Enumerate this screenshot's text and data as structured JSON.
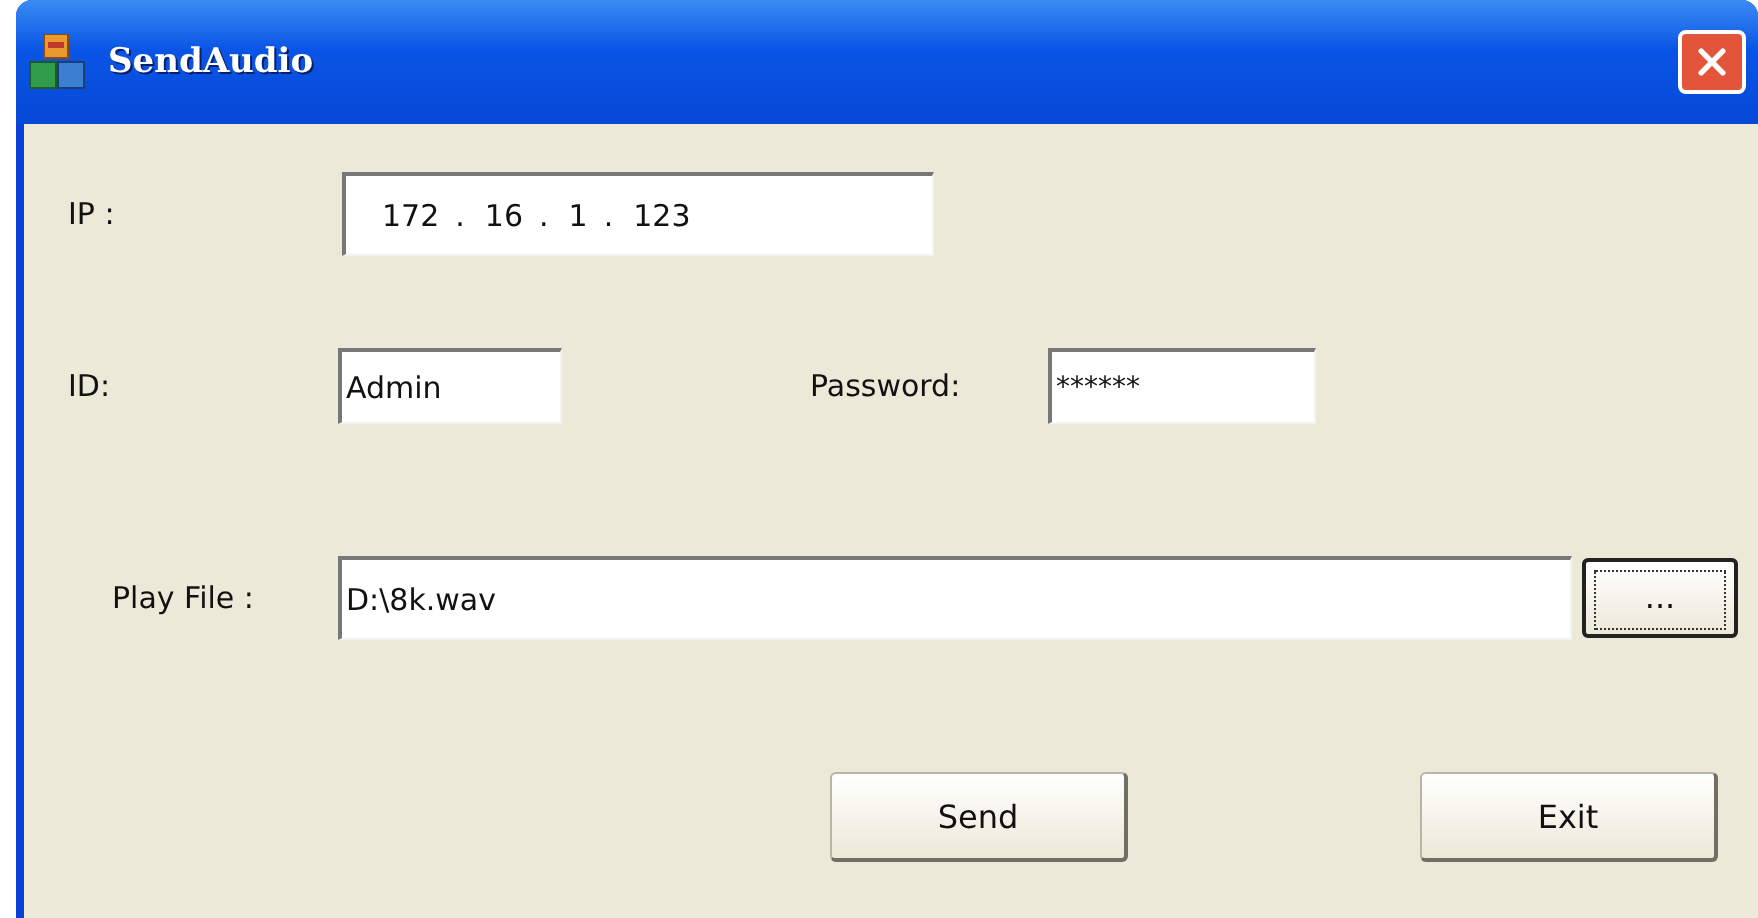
{
  "window": {
    "title": "SendAudio"
  },
  "ip": {
    "label": "IP :",
    "octets": [
      {
        "value": "172"
      },
      {
        "dot": ".",
        "value": "16"
      },
      {
        "dot": ".",
        "value": "1"
      },
      {
        "dot": ".",
        "value": "123"
      }
    ]
  },
  "id": {
    "label": "ID:",
    "value": "Admin"
  },
  "password": {
    "label": "Password:",
    "value": "******"
  },
  "play_file": {
    "label": "Play File :",
    "value": "D:\\8k.wav",
    "browse_button": "..."
  },
  "buttons": [
    {
      "label": "Send"
    },
    {
      "label": "Exit"
    }
  ]
}
